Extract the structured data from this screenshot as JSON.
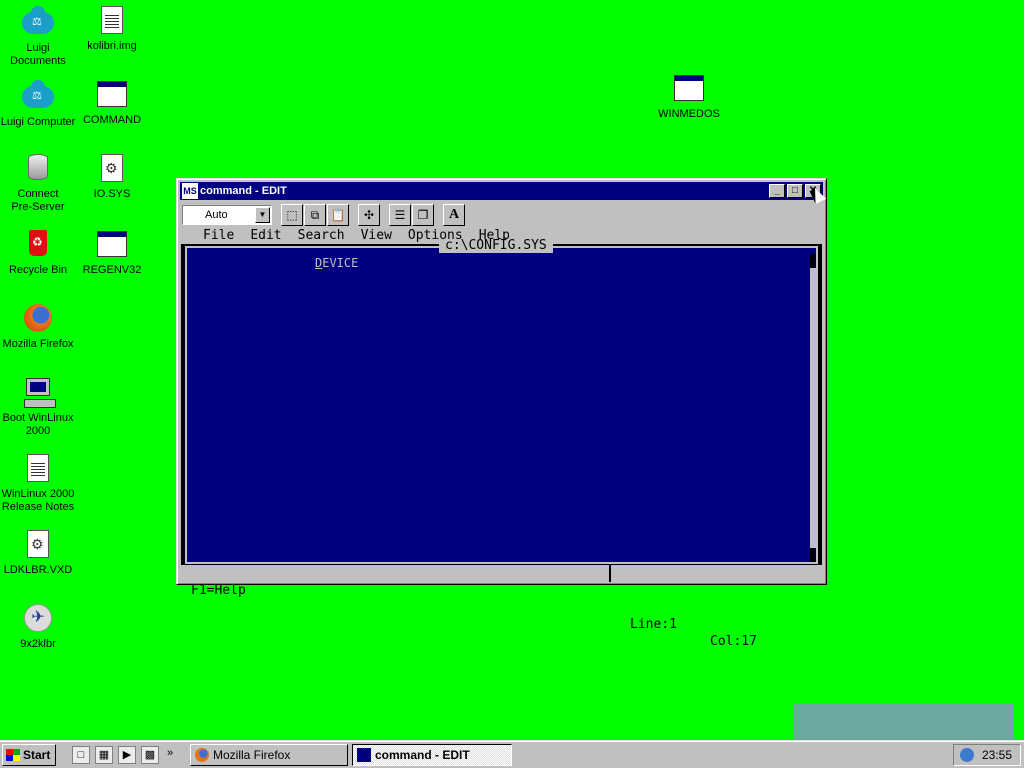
{
  "desktop": {
    "icons": [
      {
        "label1": "Luigi",
        "label2": "Documents",
        "icon": "cloud-icon"
      },
      {
        "label1": "kolibri.img",
        "label2": "",
        "icon": "disk-image-icon"
      },
      {
        "label1": "Luigi Computer",
        "label2": "",
        "icon": "cloud-icon"
      },
      {
        "label1": "COMMAND",
        "label2": "",
        "icon": "window-icon"
      },
      {
        "label1": "Connect",
        "label2": "Pre-Server",
        "icon": "database-icon"
      },
      {
        "label1": "IO.SYS",
        "label2": "",
        "icon": "system-file-icon"
      },
      {
        "label1": "Recycle Bin",
        "label2": "",
        "icon": "recycle-bin-icon"
      },
      {
        "label1": "REGENV32",
        "label2": "",
        "icon": "window-icon"
      },
      {
        "label1": "Mozilla Firefox",
        "label2": "",
        "icon": "firefox-icon"
      },
      {
        "label1": "Boot WinLinux",
        "label2": "2000",
        "icon": "computer-icon"
      },
      {
        "label1": "WinLinux 2000",
        "label2": "Release Notes",
        "icon": "text-document-icon"
      },
      {
        "label1": "LDKLBR.VXD",
        "label2": "",
        "icon": "system-file-icon"
      },
      {
        "label1": "9x2klbr",
        "label2": "",
        "icon": "plane-icon"
      },
      {
        "label1": "WINMEDOS",
        "label2": "",
        "icon": "window-icon"
      }
    ]
  },
  "window": {
    "title": "command - EDIT",
    "app_icon_text": "MS",
    "toolbar": {
      "font_combo": "Auto",
      "font_button": "A"
    },
    "dos": {
      "menu": [
        "File",
        "Edit",
        "Search",
        "View",
        "Options",
        "Help"
      ],
      "file_title": "c:\\CONFIG.SYS",
      "text_first": "D",
      "text_rest": "EVICE",
      "status_help": "F1=Help",
      "status_line": "Line:1",
      "status_col": "Col:17"
    }
  },
  "taskbar": {
    "start_label": "Start",
    "tasks": [
      {
        "label": "Mozilla Firefox"
      },
      {
        "label": "command - EDIT"
      }
    ],
    "clock": "23:55"
  },
  "colors": {
    "desktop": "#00ff00",
    "titlebar": "#000080",
    "editor_bg": "#000080"
  }
}
